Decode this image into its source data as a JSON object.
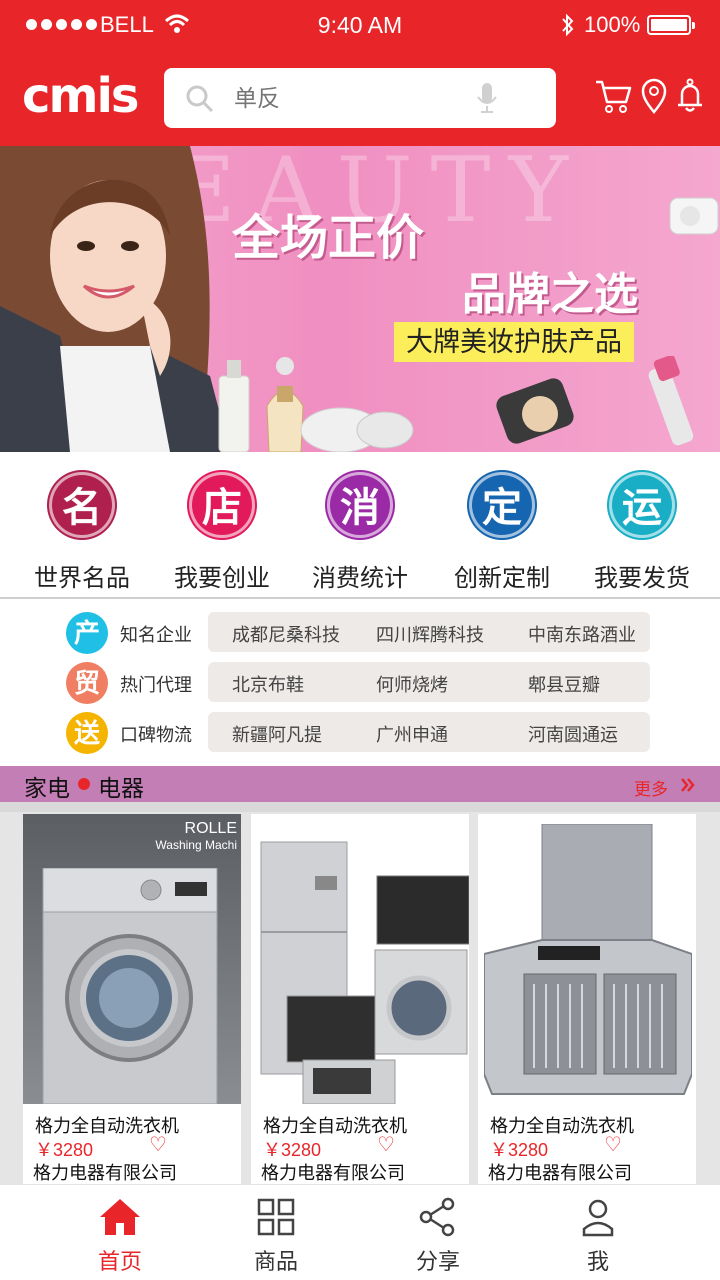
{
  "status": {
    "carrier": "BELL",
    "time": "9:40 AM",
    "battery": "100%"
  },
  "header": {
    "logo": "cmis",
    "search_placeholder": "单反",
    "icons": [
      "cart-icon",
      "location-icon",
      "bell-icon"
    ]
  },
  "banner": {
    "bg_word": "EAUTY",
    "headline": "全场正价",
    "subhead": "品牌之选",
    "tagline": "大牌美妆护肤产品"
  },
  "categories": [
    {
      "glyph": "名",
      "label": "世界名品",
      "color": "#b0204e"
    },
    {
      "glyph": "店",
      "label": "我要创业",
      "color": "#e21a5c"
    },
    {
      "glyph": "消",
      "label": "消费统计",
      "color": "#9b2aa6"
    },
    {
      "glyph": "定",
      "label": "创新定制",
      "color": "#1565b0"
    },
    {
      "glyph": "运",
      "label": "我要发货",
      "color": "#19aec6"
    }
  ],
  "info_rows": [
    {
      "glyph": "产",
      "title": "知名企业",
      "color": "#20c0e6",
      "items": [
        "成都尼桑科技",
        "四川辉腾科技",
        "中南东路酒业"
      ]
    },
    {
      "glyph": "贸",
      "title": "热门代理",
      "color": "#f07e62",
      "items": [
        "北京布鞋",
        "何师烧烤",
        "郫县豆瓣"
      ]
    },
    {
      "glyph": "送",
      "title": "口碑物流",
      "color": "#f5b400",
      "items": [
        "新疆阿凡提",
        "广州申通",
        "河南圆通运"
      ]
    }
  ],
  "section": {
    "title_left": "家电",
    "title_right": "电器",
    "more": "更多"
  },
  "products": [
    {
      "name": "格力全自动洗衣机",
      "price": "￥3280",
      "company": "格力电器有限公司",
      "img_text_1": "ROLLE",
      "img_text_2": "Washing Machi"
    },
    {
      "name": "格力全自动洗衣机",
      "price": "￥3280",
      "company": "格力电器有限公司"
    },
    {
      "name": "格力全自动洗衣机",
      "price": "￥3280",
      "company": "格力电器有限公司"
    }
  ],
  "tabs": [
    {
      "label": "首页",
      "icon": "home-icon",
      "active": true
    },
    {
      "label": "商品",
      "icon": "grid-icon",
      "active": false
    },
    {
      "label": "分享",
      "icon": "share-icon",
      "active": false
    },
    {
      "label": "我",
      "icon": "user-icon",
      "active": false
    }
  ]
}
